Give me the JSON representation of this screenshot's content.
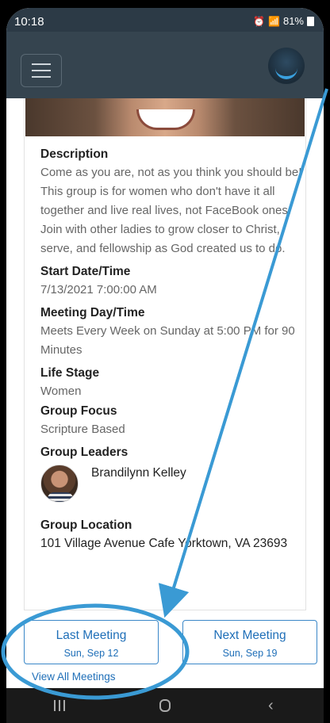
{
  "status": {
    "time": "10:18",
    "battery": "81%"
  },
  "group": {
    "description_label": "Description",
    "description": "Come as you are, not as you think you should be! This group is for women who don't have it all together and live real lives, not FaceBook ones. Join with other ladies to grow closer to Christ, serve, and fellowship as God created us to do.",
    "start_label": "Start Date/Time",
    "start_value": "7/13/2021 7:00:00 AM",
    "meeting_label": "Meeting Day/Time",
    "meeting_value": "Meets Every Week on Sunday at 5:00 PM for 90 Minutes",
    "life_stage_label": "Life Stage",
    "life_stage_value": "Women",
    "focus_label": "Group Focus",
    "focus_value": "Scripture Based",
    "leaders_label": "Group Leaders",
    "leader_name": "Brandilynn Kelley",
    "location_label": "Group Location",
    "location_value": "101 Village Avenue Cafe Yorktown, VA 23693"
  },
  "meetings": {
    "last_label": "Last Meeting",
    "last_date": "Sun, Sep 12",
    "next_label": "Next Meeting",
    "next_date": "Sun, Sep 19",
    "view_all": "View All Meetings"
  },
  "colors": {
    "accent": "#1f6fb8",
    "header": "#35444f",
    "annotation": "#3a9ad4"
  },
  "icons": [
    "menu-icon",
    "app-logo-icon",
    "wifi-icon",
    "signal-icon",
    "battery-icon",
    "recents-icon",
    "home-icon",
    "back-icon"
  ]
}
